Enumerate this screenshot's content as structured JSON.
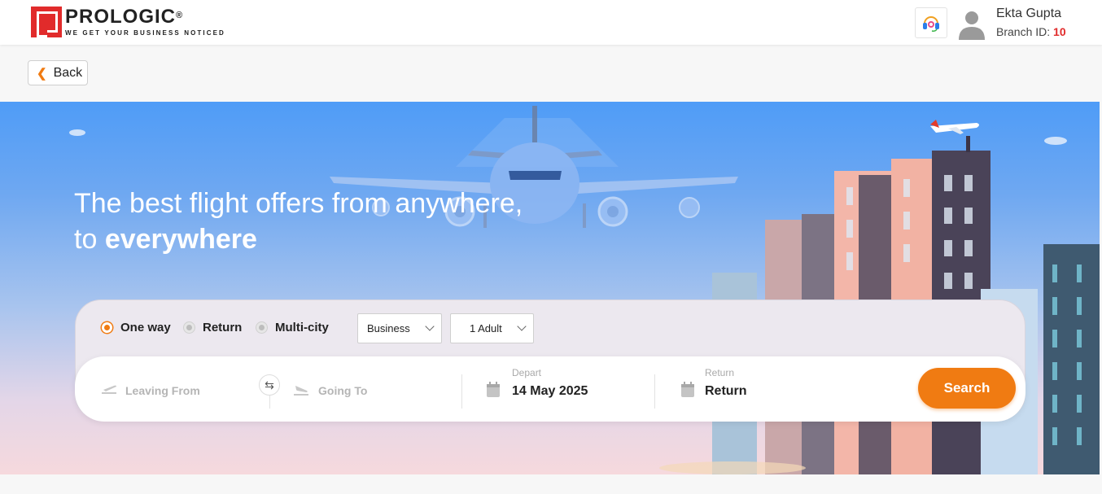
{
  "header": {
    "brand_name": "PROLOGIC",
    "brand_reg": "®",
    "brand_tagline": "WE GET YOUR BUSINESS NOTICED",
    "support_icon": "headset-icon",
    "user_name": "Ekta Gupta",
    "branch_label": "Branch ID:",
    "branch_id": "10"
  },
  "back": {
    "label": "Back"
  },
  "hero": {
    "line1": "The best flight offers from anywhere,",
    "line2_prefix": "to ",
    "line2_bold": "everywhere"
  },
  "search": {
    "trip_types": [
      {
        "label": "One way",
        "selected": true
      },
      {
        "label": "Return",
        "selected": false
      },
      {
        "label": "Multi-city",
        "selected": false
      }
    ],
    "cabin_class": "Business",
    "travellers": "1 Adult",
    "leaving_from_placeholder": "Leaving From",
    "going_to_placeholder": "Going To",
    "depart_label": "Depart",
    "depart_value": "14 May 2025",
    "return_label": "Return",
    "return_value": "Return",
    "search_label": "Search"
  },
  "colors": {
    "accent": "#f07b12",
    "brand_red": "#e12b2b",
    "sky_top": "#4f9cf7"
  }
}
